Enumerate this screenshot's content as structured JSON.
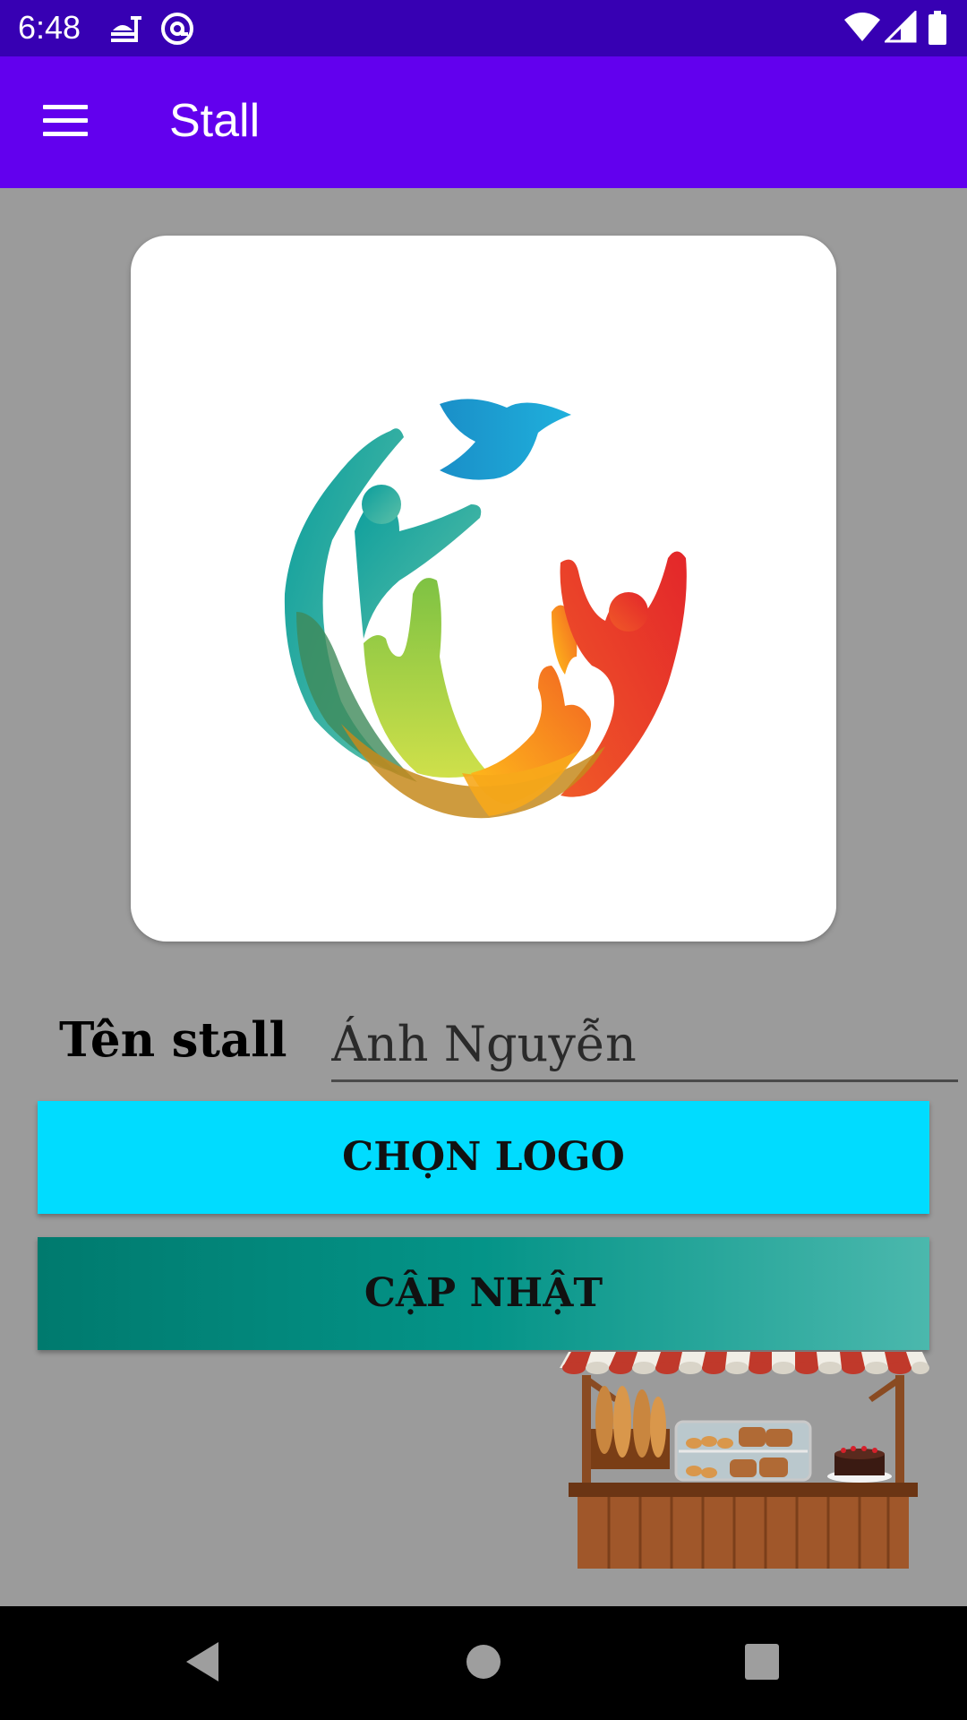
{
  "status_bar": {
    "time": "6:48",
    "notification_icons": [
      "fastfood-icon",
      "at-sign-icon"
    ],
    "system_icons": [
      "wifi-icon",
      "signal-icon",
      "battery-icon"
    ]
  },
  "app_bar": {
    "title": "Stall",
    "menu_icon": "hamburger-menu-icon",
    "color": "#6200ee"
  },
  "logo_card": {
    "logo_icon": "people-globe-logo-icon"
  },
  "form": {
    "name_label": "Tên stall",
    "name_value": "Ánh Nguyễn"
  },
  "buttons": {
    "choose_logo": "CHỌN LOGO",
    "update": "CẬP NHẬT"
  },
  "colors": {
    "status_bar": "#3700b3",
    "app_bar": "#6200ee",
    "background": "#9b9b9b",
    "choose_logo_button": "#00dcff",
    "update_button_start": "#007a6e",
    "update_button_end": "#4bb8ad"
  },
  "nav_bar": {
    "icons": [
      "back-icon",
      "home-icon",
      "recent-apps-icon"
    ]
  }
}
